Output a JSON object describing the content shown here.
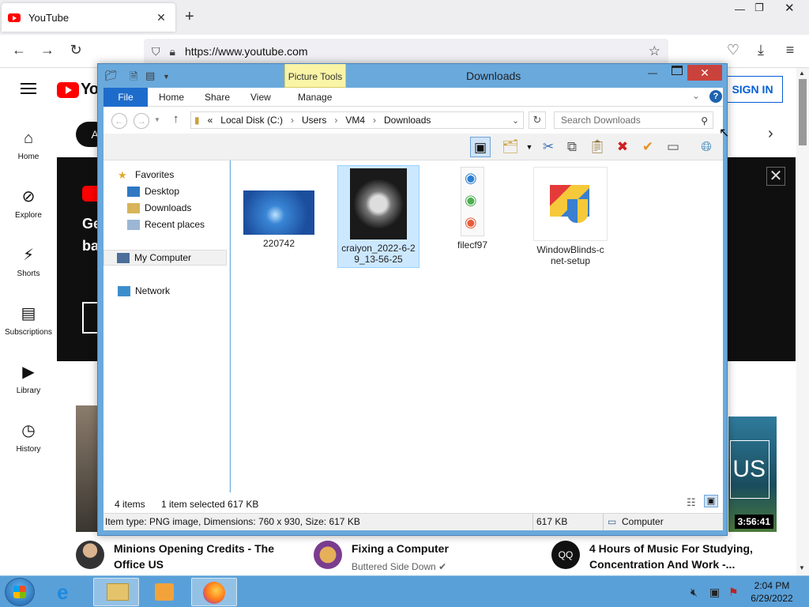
{
  "browser": {
    "tab_title": "YouTube",
    "url": "https://www.youtube.com"
  },
  "youtube": {
    "logo_text": "Yo",
    "sign_in": "SIGN IN",
    "chip": "Al",
    "sidebar": [
      {
        "label": "Home",
        "icon": "home-icon"
      },
      {
        "label": "Explore",
        "icon": "compass-icon"
      },
      {
        "label": "Shorts",
        "icon": "shorts-icon"
      },
      {
        "label": "Subscriptions",
        "icon": "subscriptions-icon"
      },
      {
        "label": "Library",
        "icon": "library-icon"
      },
      {
        "label": "History",
        "icon": "history-icon"
      }
    ],
    "banner": {
      "line1": "Ge",
      "line2": "ba"
    },
    "thumb_right": {
      "duration": "3:56:41",
      "overlay": "US"
    },
    "videos": [
      {
        "title_line1": "Minions Opening Credits - The",
        "title_line2": "Office US",
        "channel": ""
      },
      {
        "title_line1": "Fixing a Computer",
        "title_line2": "",
        "channel": "Buttered Side Down"
      },
      {
        "title_line1": "4 Hours of Music For Studying,",
        "title_line2": "Concentration And Work -...",
        "channel": "",
        "avatar_text": "QQ"
      }
    ]
  },
  "explorer": {
    "title": "Downloads",
    "contextual_tab": "Picture Tools",
    "ribbon_tabs": [
      "File",
      "Home",
      "Share",
      "View",
      "Manage"
    ],
    "address": {
      "prefix": "«",
      "parts": [
        "Local Disk (C:)",
        "Users",
        "VM4",
        "Downloads"
      ]
    },
    "search_placeholder": "Search Downloads",
    "nav": {
      "favorites": "Favorites",
      "desktop": "Desktop",
      "downloads": "Downloads",
      "recent": "Recent places",
      "mycomputer": "My Computer",
      "network": "Network"
    },
    "files": [
      {
        "name_l1": "220742",
        "name_l2": ""
      },
      {
        "name_l1": "craiyon_2022-6-2",
        "name_l2": "9_13-56-25"
      },
      {
        "name_l1": "filecf97",
        "name_l2": ""
      },
      {
        "name_l1": "WindowBlinds-c",
        "name_l2": "net-setup"
      }
    ],
    "status": {
      "count": "4 items",
      "selected": "1 item selected  617 KB"
    },
    "details": {
      "item": "Item type: PNG image, Dimensions: 760 x 930, Size: 617 KB",
      "size": "617 KB",
      "location": "Computer"
    }
  },
  "taskbar": {
    "time": "2:04 PM",
    "date": "6/29/2022"
  }
}
